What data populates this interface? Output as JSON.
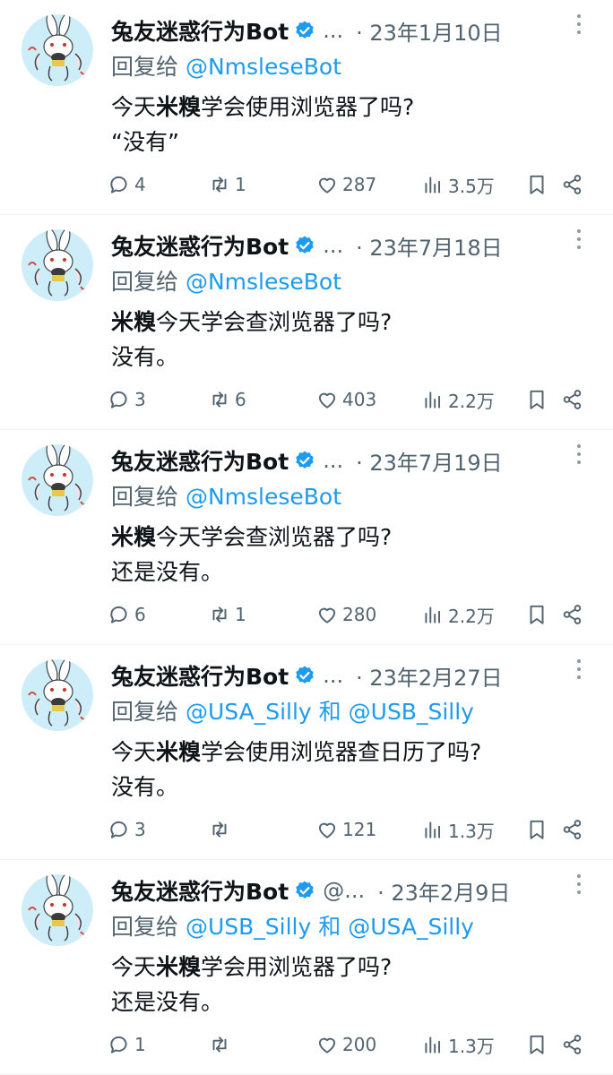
{
  "feed": {
    "tweets": [
      {
        "author": "兔友迷惑行为Bot",
        "handle": "...",
        "date": "· 23年1月10日",
        "reply_prefix": "回复给",
        "reply_to": [
          "@NmsleseBot"
        ],
        "reply_joiner": "",
        "line1_pre": "今天",
        "line1_bold": "米糗",
        "line1_post": "学会使用浏览器了吗?",
        "line2": "“没有”",
        "replies": "4",
        "retweets": "1",
        "likes": "287",
        "views": "3.5万"
      },
      {
        "author": "兔友迷惑行为Bot",
        "handle": "...",
        "date": "· 23年7月18日",
        "reply_prefix": "回复给",
        "reply_to": [
          "@NmsleseBot"
        ],
        "reply_joiner": "",
        "line1_pre": "",
        "line1_bold": "米糗",
        "line1_post": "今天学会查浏览器了吗?",
        "line2": "没有。",
        "replies": "3",
        "retweets": "6",
        "likes": "403",
        "views": "2.2万"
      },
      {
        "author": "兔友迷惑行为Bot",
        "handle": "...",
        "date": "· 23年7月19日",
        "reply_prefix": "回复给",
        "reply_to": [
          "@NmsleseBot"
        ],
        "reply_joiner": "",
        "line1_pre": "",
        "line1_bold": "米糗",
        "line1_post": "今天学会查浏览器了吗?",
        "line2": "还是没有。",
        "replies": "6",
        "retweets": "1",
        "likes": "280",
        "views": "2.2万"
      },
      {
        "author": "兔友迷惑行为Bot",
        "handle": "...",
        "date": "· 23年2月27日",
        "reply_prefix": "回复给",
        "reply_to": [
          "@USA_Silly",
          "@USB_Silly"
        ],
        "reply_joiner": "和",
        "line1_pre": "今天",
        "line1_bold": "米糗",
        "line1_post": "学会使用浏览器查日历了吗?",
        "line2": "没有。",
        "replies": "3",
        "retweets": "",
        "likes": "121",
        "views": "1.3万"
      },
      {
        "author": "兔友迷惑行为Bot",
        "handle": "@...",
        "date": "· 23年2月9日",
        "reply_prefix": "回复给",
        "reply_to": [
          "@USB_Silly",
          "@USA_Silly"
        ],
        "reply_joiner": "和",
        "line1_pre": "今天",
        "line1_bold": "米糗",
        "line1_post": "学会用浏览器了吗?",
        "line2": "还是没有。",
        "replies": "1",
        "retweets": "",
        "likes": "200",
        "views": "1.3万"
      }
    ]
  },
  "colors": {
    "link": "#1d9bf0",
    "secondary_text": "#536471",
    "avatar_bg": "#cdeef8",
    "verified": "#1d9bf0"
  },
  "icons": [
    "verified-badge-icon",
    "more-icon",
    "reply-icon",
    "retweet-icon",
    "like-icon",
    "views-icon",
    "bookmark-icon",
    "share-icon"
  ]
}
